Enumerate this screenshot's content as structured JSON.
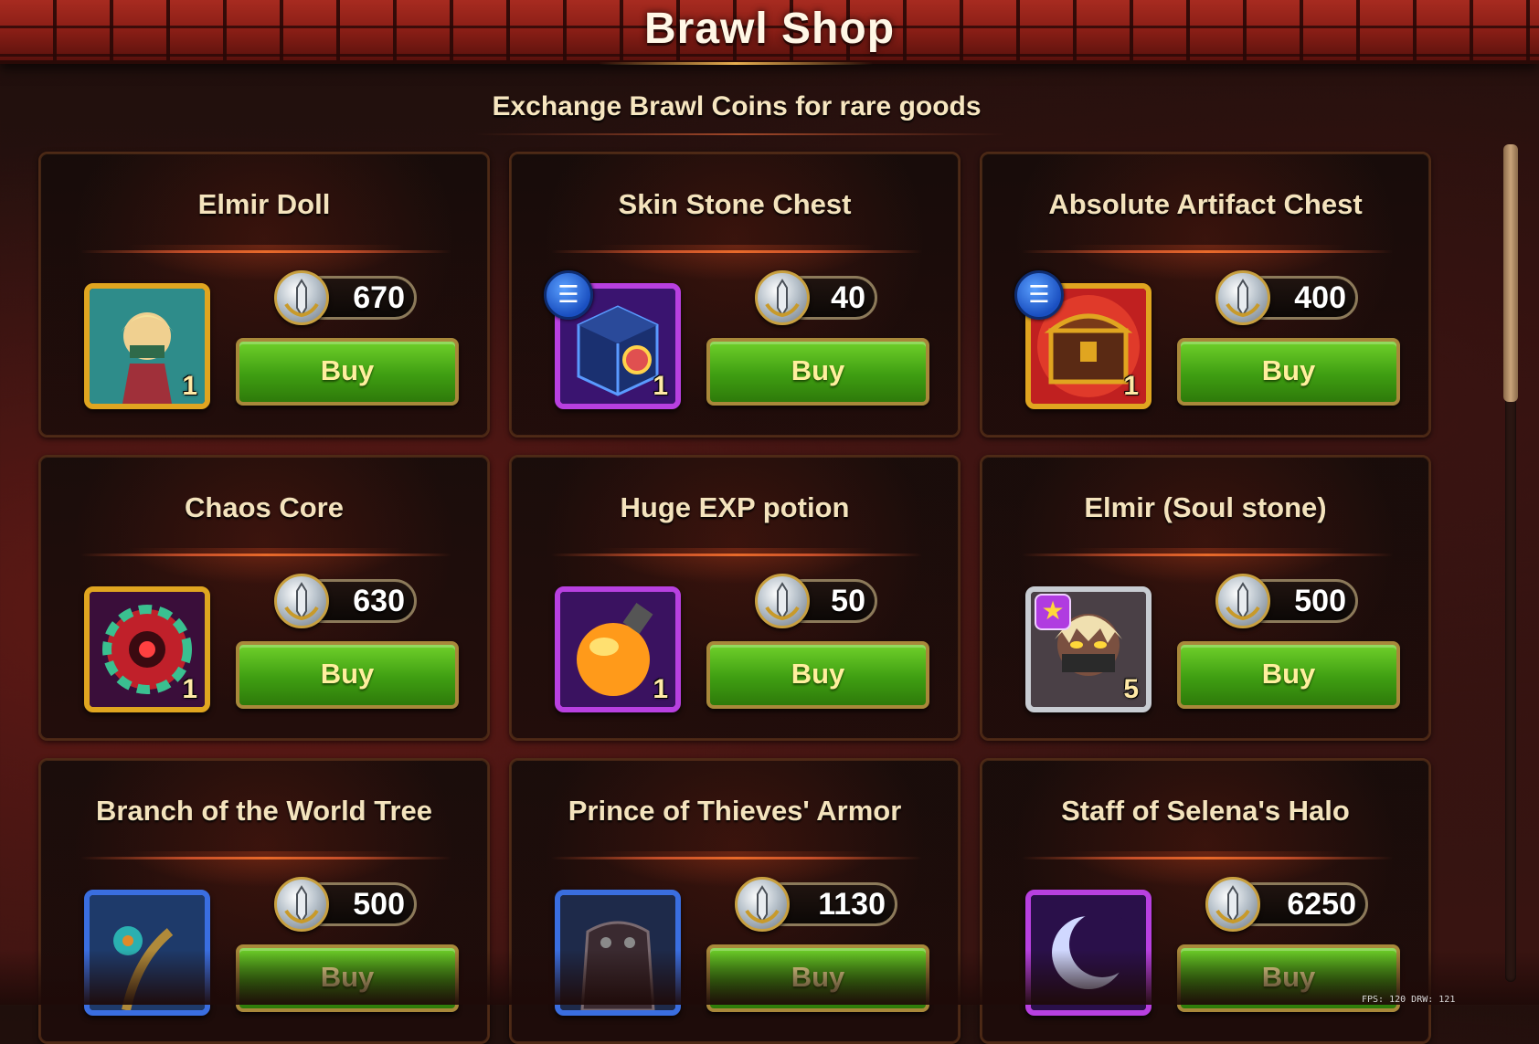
{
  "header": {
    "title": "Brawl Shop"
  },
  "subtitle": "Exchange Brawl Coins for rare goods",
  "currency_icon": "brawl-coin-icon",
  "items": [
    {
      "name": "Elmir Doll",
      "price": "670",
      "qty": "1",
      "buy_label": "Buy",
      "frame": "gold",
      "icon": "elmir-doll-icon",
      "badge": ""
    },
    {
      "name": "Skin Stone Chest",
      "price": "40",
      "qty": "1",
      "buy_label": "Buy",
      "frame": "purple",
      "icon": "skin-stone-chest-icon",
      "badge": "info"
    },
    {
      "name": "Absolute Artifact Chest",
      "price": "400",
      "qty": "1",
      "buy_label": "Buy",
      "frame": "gold",
      "icon": "artifact-chest-icon",
      "badge": "info"
    },
    {
      "name": "Chaos Core",
      "price": "630",
      "qty": "1",
      "buy_label": "Buy",
      "frame": "gold",
      "icon": "chaos-core-icon",
      "badge": ""
    },
    {
      "name": "Huge EXP potion",
      "price": "50",
      "qty": "1",
      "buy_label": "Buy",
      "frame": "purple",
      "icon": "exp-potion-icon",
      "badge": ""
    },
    {
      "name": "Elmir (Soul stone)",
      "price": "500",
      "qty": "5",
      "buy_label": "Buy",
      "frame": "silver",
      "icon": "elmir-soul-stone-icon",
      "badge": "star"
    },
    {
      "name": "Branch of the World Tree",
      "price": "500",
      "qty": "",
      "buy_label": "Buy",
      "frame": "blue",
      "icon": "world-tree-branch-icon",
      "badge": ""
    },
    {
      "name": "Prince of Thieves' Armor",
      "price": "1130",
      "qty": "",
      "buy_label": "Buy",
      "frame": "blue",
      "icon": "thieves-armor-icon",
      "badge": ""
    },
    {
      "name": "Staff of Selena's Halo",
      "price": "6250",
      "qty": "",
      "buy_label": "Buy",
      "frame": "purple",
      "icon": "selena-halo-staff-icon",
      "badge": ""
    }
  ],
  "overlay": {
    "fps_text": "FPS: 120   DRW: 121"
  },
  "colors": {
    "buy_green": "#3f9e12",
    "gold_frame": "#e0a520",
    "purple_frame": "#b840e0",
    "header_red": "#8a1e16"
  }
}
